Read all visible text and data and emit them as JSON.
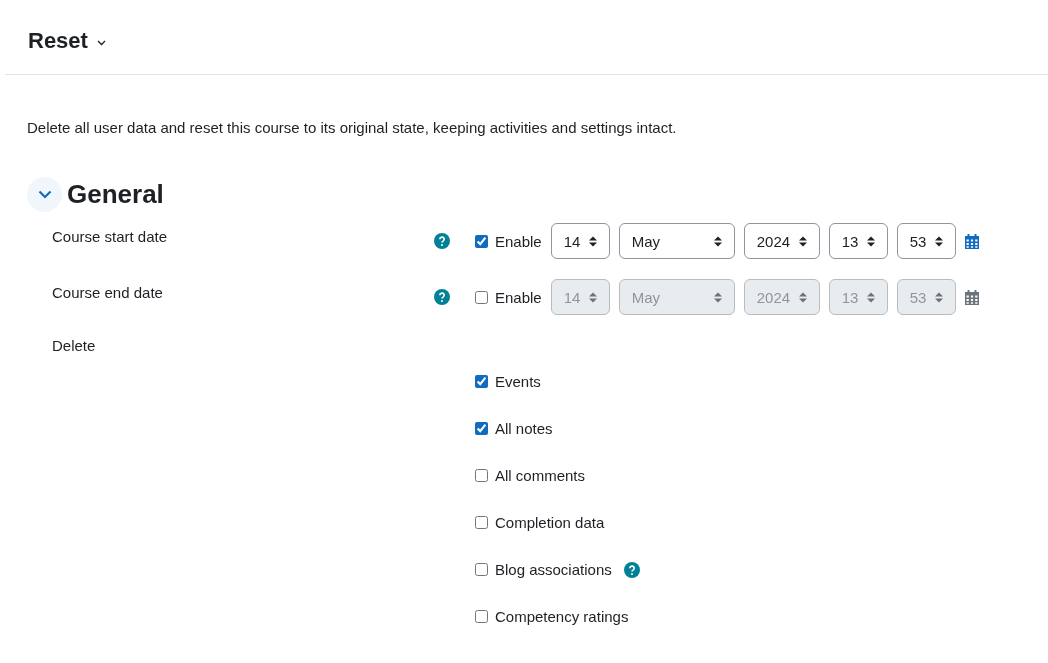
{
  "header": {
    "title": "Reset"
  },
  "description": "Delete all user data and reset this course to its original state, keeping activities and settings intact.",
  "section": {
    "title": "General",
    "expanded": true
  },
  "date_fields": [
    {
      "label": "Course start date",
      "help": true,
      "enable_label": "Enable",
      "enabled": true,
      "day": "14",
      "month": "May",
      "year": "2024",
      "hour": "13",
      "minute": "53"
    },
    {
      "label": "Course end date",
      "help": true,
      "enable_label": "Enable",
      "enabled": false,
      "day": "14",
      "month": "May",
      "year": "2024",
      "hour": "13",
      "minute": "53"
    }
  ],
  "delete": {
    "label": "Delete",
    "options": [
      {
        "label": "Events",
        "checked": true,
        "help": false
      },
      {
        "label": "All notes",
        "checked": true,
        "help": false
      },
      {
        "label": "All comments",
        "checked": false,
        "help": false
      },
      {
        "label": "Completion data",
        "checked": false,
        "help": false
      },
      {
        "label": "Blog associations",
        "checked": false,
        "help": true
      },
      {
        "label": "Competency ratings",
        "checked": false,
        "help": false
      }
    ]
  }
}
